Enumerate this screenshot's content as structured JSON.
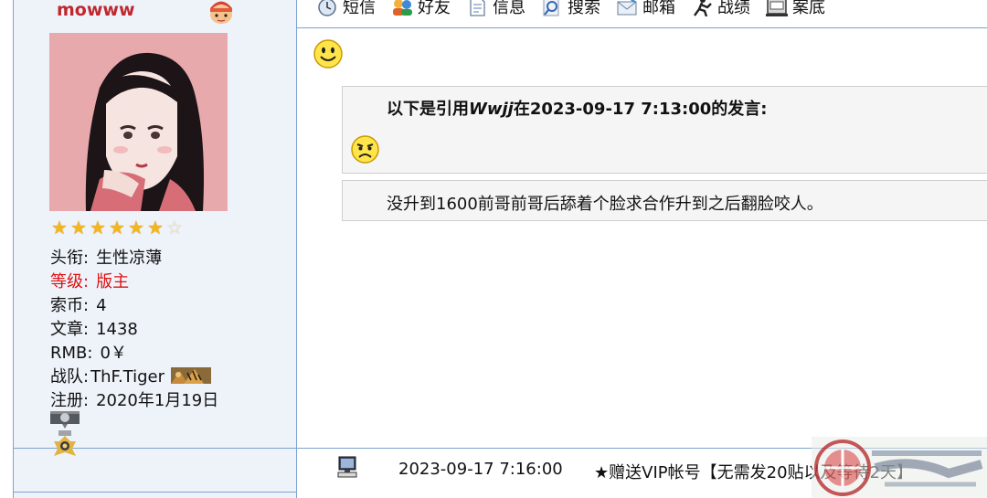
{
  "user": {
    "name": "mowww",
    "stars_filled": 6,
    "stars_total": 7,
    "fields": [
      {
        "label": "头衔:",
        "value": "生性凉薄",
        "highlight": false
      },
      {
        "label": "等级:",
        "value": "版主",
        "highlight": true
      },
      {
        "label": "索币:",
        "value": "4",
        "highlight": false
      },
      {
        "label": "文章:",
        "value": "1438",
        "highlight": false
      },
      {
        "label": "RMB:",
        "value": "0￥",
        "highlight": false
      },
      {
        "label": "战队:",
        "value": "ThF.Tiger",
        "highlight": false
      },
      {
        "label": "注册:",
        "value": "2020年1月19日",
        "highlight": false
      }
    ]
  },
  "toolbar": {
    "items": [
      {
        "label": "短信",
        "icon": "message-icon"
      },
      {
        "label": "好友",
        "icon": "friends-icon"
      },
      {
        "label": "信息",
        "icon": "info-icon"
      },
      {
        "label": "搜索",
        "icon": "search-icon"
      },
      {
        "label": "邮箱",
        "icon": "mail-icon"
      },
      {
        "label": "战绩",
        "icon": "record-icon"
      },
      {
        "label": "案底",
        "icon": "case-icon"
      }
    ]
  },
  "post": {
    "quote_prefix": "以下是引用",
    "quote_author": "Wwjj",
    "quote_middle": "在",
    "quote_time": "2023-09-17 7:13:00",
    "quote_suffix": "的发言:",
    "content": "没升到1600前哥前哥后舔着个脸求合作升到之后翻脸咬人。",
    "time": "2023-09-17 7:16:00",
    "vip_link": "★赠送VIP帐号【无需发20贴以及等待2天】"
  },
  "colors": {
    "border": "#7ea3cf",
    "panel": "#eef3fa",
    "username": "#c0282f",
    "highlight": "#d11111"
  }
}
